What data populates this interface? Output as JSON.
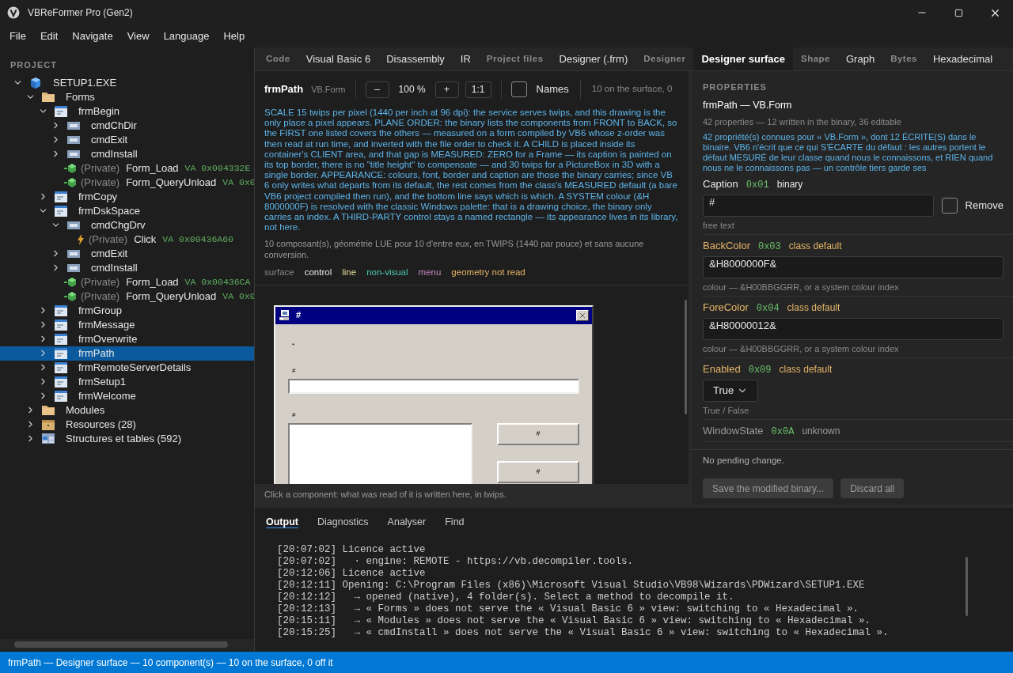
{
  "window": {
    "title": "VBReFormer Pro (Gen2)"
  },
  "menu": [
    "File",
    "Edit",
    "Navigate",
    "View",
    "Language",
    "Help"
  ],
  "project": {
    "heading": "PROJECT",
    "tree": [
      {
        "label": "SETUP1.EXE",
        "kind": "exe",
        "expanded": true,
        "selected": false,
        "children": [
          {
            "label": "Forms",
            "kind": "folder",
            "expanded": true,
            "selected": false,
            "children": [
              {
                "label": "frmBegin",
                "kind": "form",
                "expanded": true,
                "selected": false,
                "children": [
                  {
                    "label": "cmdChDir",
                    "kind": "control",
                    "expanded": false,
                    "selected": false
                  },
                  {
                    "label": "cmdExit",
                    "kind": "control",
                    "expanded": false,
                    "selected": false
                  },
                  {
                    "label": "cmdInstall",
                    "kind": "control",
                    "expanded": false,
                    "selected": false
                  },
                  {
                    "scope": "(Private)",
                    "label": "Form_Load",
                    "kind": "method",
                    "address": "VA 0x004332E",
                    "selected": false
                  },
                  {
                    "scope": "(Private)",
                    "label": "Form_QueryUnload",
                    "kind": "method",
                    "address": "VA 0x0",
                    "selected": false
                  }
                ]
              },
              {
                "label": "frmCopy",
                "kind": "form",
                "expanded": false,
                "selected": false
              },
              {
                "label": "frmDskSpace",
                "kind": "form",
                "expanded": true,
                "selected": false,
                "children": [
                  {
                    "label": "cmdChgDrv",
                    "kind": "control",
                    "expanded": true,
                    "selected": false,
                    "children": [
                      {
                        "scope": "(Private)",
                        "label": "Click",
                        "kind": "event",
                        "address": "VA 0x00436A60",
                        "selected": false
                      }
                    ]
                  },
                  {
                    "label": "cmdExit",
                    "kind": "control",
                    "expanded": false,
                    "selected": false
                  },
                  {
                    "label": "cmdInstall",
                    "kind": "control",
                    "expanded": false,
                    "selected": false
                  },
                  {
                    "scope": "(Private)",
                    "label": "Form_Load",
                    "kind": "method",
                    "address": "VA 0x00436CA",
                    "selected": false
                  },
                  {
                    "scope": "(Private)",
                    "label": "Form_QueryUnload",
                    "kind": "method",
                    "address": "VA 0x0",
                    "selected": false
                  }
                ]
              },
              {
                "label": "frmGroup",
                "kind": "form",
                "expanded": false,
                "selected": false
              },
              {
                "label": "frmMessage",
                "kind": "form",
                "expanded": false,
                "selected": false
              },
              {
                "label": "frmOverwrite",
                "kind": "form",
                "expanded": false,
                "selected": false
              },
              {
                "label": "frmPath",
                "kind": "form",
                "expanded": false,
                "selected": true
              },
              {
                "label": "frmRemoteServerDetails",
                "kind": "form",
                "expanded": false,
                "selected": false
              },
              {
                "label": "frmSetup1",
                "kind": "form",
                "expanded": false,
                "selected": false
              },
              {
                "label": "frmWelcome",
                "kind": "form",
                "expanded": false,
                "selected": false
              }
            ]
          },
          {
            "label": "Modules",
            "kind": "folder",
            "expanded": false,
            "selected": false
          },
          {
            "label": "Resources (28)",
            "kind": "resources",
            "expanded": false,
            "selected": false
          },
          {
            "label": "Structures et tables (592)",
            "kind": "table",
            "expanded": false,
            "selected": false
          }
        ]
      }
    ]
  },
  "tabs": [
    {
      "label": "Code",
      "kind": "group",
      "selected": false
    },
    {
      "label": "Visual Basic 6",
      "kind": "view",
      "selected": false
    },
    {
      "label": "Disassembly",
      "kind": "view",
      "selected": false
    },
    {
      "label": "IR",
      "kind": "view",
      "selected": false
    },
    {
      "label": "Project files",
      "kind": "group",
      "selected": false
    },
    {
      "label": "Designer (.frm)",
      "kind": "view",
      "selected": false
    },
    {
      "label": "Designer",
      "kind": "group",
      "selected": false
    },
    {
      "label": "Designer surface",
      "kind": "view",
      "selected": true
    },
    {
      "label": "Shape",
      "kind": "group",
      "selected": false
    },
    {
      "label": "Graph",
      "kind": "view",
      "selected": false
    },
    {
      "label": "Bytes",
      "kind": "group",
      "selected": false
    },
    {
      "label": "Hexadecimal",
      "kind": "view",
      "selected": false
    }
  ],
  "designer": {
    "name": "frmPath",
    "class": "VB.Form",
    "zoom_out": "–",
    "zoom": "100 %",
    "zoom_in": "+",
    "actual_size": "1:1",
    "names_label": "Names",
    "names_checked": false,
    "count": "10 on the surface, 0",
    "explanation": "SCALE 15 twips per pixel (1440 per inch at 96 dpi): the service serves twips, and this drawing is the only place a pixel appears. PLANE ORDER: the binary lists the components from FRONT to BACK, so the FIRST one listed covers the others — measured on a form compiled by VB6 whose z-order was then read at run time, and inverted with the file order to check it. A CHILD is placed inside its container's CLIENT area, and that gap is MEASURED: ZERO for a Frame — its caption is painted on its top border, there is no \"title height\" to compensate — and 30 twips for a PictureBox in 3D with a single border. APPEARANCE: colours, font, border and caption are those the binary carries; since VB 6 only writes what departs from its default, the rest comes from the class's MEASURED default (a bare VB6 project compiled then run), and the bottom line says which is which. A SYSTEM colour (&H 8000000F) is resolved with the classic Windows palette: that is a drawing choice, the binary only carries an index. A THIRD-PARTY control stays a named rectangle — its appearance lives in its library, not here.",
    "summary": "10 composant(s), géométrie LUE pour 10 d'entre eux, en TWIPS (1440 par pouce) et sans aucune conversion.",
    "legend": [
      {
        "label": "surface",
        "color": "#8a8a8a"
      },
      {
        "label": "control",
        "color": "#e8e8e8"
      },
      {
        "label": "line",
        "color": "#e6dca0"
      },
      {
        "label": "non-visual",
        "color": "#4ec9b0"
      },
      {
        "label": "menu",
        "color": "#c586c0"
      },
      {
        "label": "geometry not read",
        "color": "#e5b567"
      }
    ],
    "form": {
      "caption": "#",
      "controls": [
        {
          "kind": "label",
          "text": "*"
        },
        {
          "kind": "label",
          "text": "#"
        },
        {
          "kind": "textbox"
        },
        {
          "kind": "label",
          "text": "#"
        },
        {
          "kind": "listbox"
        },
        {
          "kind": "button",
          "text": "#"
        },
        {
          "kind": "button",
          "text": "#"
        }
      ]
    },
    "hint": "Click a component: what was read of it is written here, in twips."
  },
  "properties": {
    "heading": "PROPERTIES",
    "title": "frmPath — VB.Form",
    "stats": "42 properties — 12 written in the binary, 36 editable",
    "note": "42 propriété(s) connues pour « VB.Form », dont 12 ÉCRITE(S) dans le binaire. VB6 n'écrit que ce qui S'ÉCARTE du défaut : les autres portent le défaut MESURÉ de leur classe quand nous le connaissons, et RIEN quand nous ne le connaissons pas — un contrôle tiers garde ses",
    "rows": [
      {
        "name": "Caption",
        "code": "0x01",
        "source": "binary",
        "written": true,
        "known": true,
        "kind": "text",
        "value": "#",
        "remove_label": "Remove",
        "remove_checked": false,
        "hint": "free text"
      },
      {
        "name": "BackColor",
        "code": "0x03",
        "source": "class default",
        "written": false,
        "known": true,
        "kind": "text",
        "value": "&H8000000F&",
        "hint": "colour — &H00BBGGRR, or a system colour index"
      },
      {
        "name": "ForeColor",
        "code": "0x04",
        "source": "class default",
        "written": false,
        "known": true,
        "kind": "text",
        "value": "&H80000012&",
        "hint": "colour — &H00BBGGRR, or a system colour index"
      },
      {
        "name": "Enabled",
        "code": "0x09",
        "source": "class default",
        "written": false,
        "known": true,
        "kind": "select",
        "value": "True",
        "hint": "True / False"
      },
      {
        "name": "WindowState",
        "code": "0x0A",
        "source": "unknown",
        "known": false,
        "kind": "none"
      }
    ],
    "pending": "No pending change.",
    "save": "Save the modified binary...",
    "discard": "Discard all"
  },
  "bottom_tabs": [
    {
      "label": "Output",
      "selected": true
    },
    {
      "label": "Diagnostics",
      "selected": false
    },
    {
      "label": "Analyser",
      "selected": false
    },
    {
      "label": "Find",
      "selected": false
    }
  ],
  "log": [
    "[20:07:02] Licence active",
    "[20:07:02]   · engine: REMOTE - https://vb.decompiler.tools.",
    "[20:12:06] Licence active",
    "[20:12:11] Opening: C:\\Program Files (x86)\\Microsoft Visual Studio\\VB98\\Wizards\\PDWizard\\SETUP1.EXE",
    "[20:12:12]   → opened (native), 4 folder(s). Select a method to decompile it.",
    "[20:12:13]   → « Forms » does not serve the « Visual Basic 6 » view: switching to « Hexadecimal ».",
    "[20:15:11]   → « Modules » does not serve the « Visual Basic 6 » view: switching to « Hexadecimal ».",
    "[20:15:25]   → « cmdInstall » does not serve the « Visual Basic 6 » view: switching to « Hexadecimal »."
  ],
  "status_bar": "frmPath — Designer surface — 10 component(s) — 10 on the surface, 0 off it"
}
